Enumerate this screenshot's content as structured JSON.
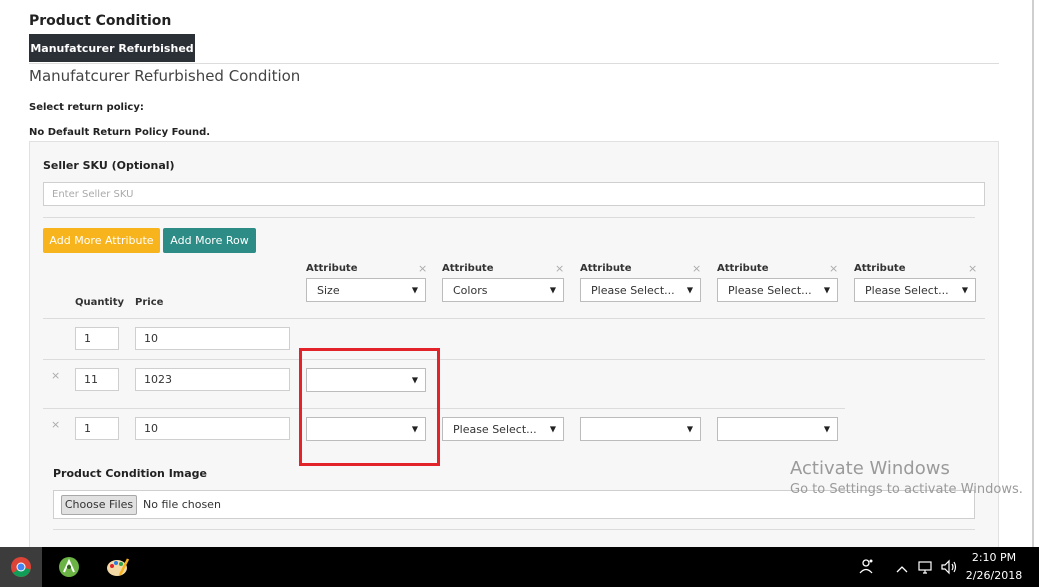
{
  "section": {
    "title": "Product Condition",
    "active_tab": "Manufatcurer Refurbished",
    "condition_heading": "Manufatcurer Refurbished Condition",
    "return_policy_label": "Select return policy:",
    "return_policy_status": "No Default Return Policy Found."
  },
  "seller_sku": {
    "label": "Seller SKU (Optional)",
    "placeholder": "Enter Seller SKU"
  },
  "buttons": {
    "add_attribute": "Add More Attribute",
    "add_row": "Add More Row"
  },
  "attributes": [
    {
      "label": "Attribute",
      "value": "Size"
    },
    {
      "label": "Attribute",
      "value": "Colors"
    },
    {
      "label": "Attribute",
      "value": "Please Select..."
    },
    {
      "label": "Attribute",
      "value": "Please Select..."
    },
    {
      "label": "Attribute",
      "value": "Please Select..."
    }
  ],
  "columns": {
    "quantity": "Quantity",
    "price": "Price"
  },
  "rows": [
    {
      "quantity": "1",
      "price": "10",
      "selects": []
    },
    {
      "quantity": "11",
      "price": "1023",
      "selects": [
        ""
      ]
    },
    {
      "quantity": "1",
      "price": "10",
      "selects": [
        "",
        "Please Select...",
        "",
        ""
      ]
    }
  ],
  "remove_glyph": "×",
  "condition_image": {
    "label": "Product Condition Image",
    "button": "Choose Files",
    "status": "No file chosen"
  },
  "watermark": {
    "line1": "Activate Windows",
    "line2": "Go to Settings to activate Windows."
  },
  "taskbar": {
    "time": "2:10 PM",
    "date": "2/26/2018",
    "apps": [
      "chrome-icon",
      "android-studio-icon",
      "paint-icon"
    ],
    "tray": [
      "people-icon",
      "chevron-up-icon",
      "network-icon",
      "volume-icon"
    ]
  },
  "colors": {
    "tab_bg": "#2b2f36",
    "add_attribute_btn": "#f8b41c",
    "add_row_btn": "#2e8c86",
    "highlight": "#e2232a"
  }
}
